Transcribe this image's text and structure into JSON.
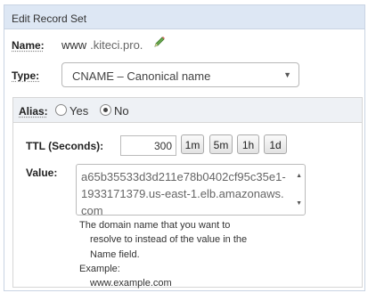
{
  "panel": {
    "title": "Edit Record Set"
  },
  "name": {
    "label": "Name:",
    "prefix": "www",
    "domain": ".kiteci.pro."
  },
  "type": {
    "label": "Type:",
    "selected": "CNAME – Canonical name"
  },
  "alias": {
    "label": "Alias:",
    "yes": "Yes",
    "no": "No",
    "selected": "No"
  },
  "ttl": {
    "label": "TTL (Seconds):",
    "value": "300",
    "buttons": [
      "1m",
      "5m",
      "1h",
      "1d"
    ]
  },
  "value": {
    "label": "Value:",
    "text": "a65b35533d3d211e78b0402cf95c35e1-1933171379.us-east-1.elb.amazonaws.com"
  },
  "help": {
    "line1": "The domain name that you want to",
    "line2": "resolve to instead of the value in the",
    "line3": "Name field.",
    "line4": "Example:",
    "line5": "www.example.com"
  },
  "icons": {
    "edit": "pencil-icon",
    "select_caret": "chevron-down-icon"
  },
  "colors": {
    "header_bg": "#dde7f4",
    "alias_bg": "#eef1f5",
    "pencil_green": "#6aa84f"
  }
}
